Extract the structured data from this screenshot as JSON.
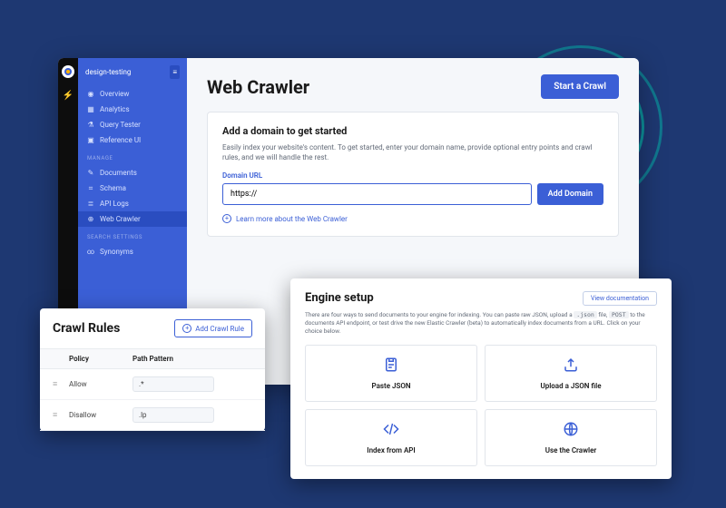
{
  "sidebar": {
    "project_name": "design-testing",
    "groups": [
      {
        "label": "",
        "items": [
          {
            "label": "Overview",
            "icon": "eye"
          },
          {
            "label": "Analytics",
            "icon": "bars"
          },
          {
            "label": "Query Tester",
            "icon": "flask"
          },
          {
            "label": "Reference UI",
            "icon": "layout"
          }
        ]
      },
      {
        "label": "MANAGE",
        "items": [
          {
            "label": "Documents",
            "icon": "doc"
          },
          {
            "label": "Schema",
            "icon": "schema"
          },
          {
            "label": "API Logs",
            "icon": "logs"
          },
          {
            "label": "Web Crawler",
            "icon": "globe",
            "active": true
          }
        ]
      },
      {
        "label": "SEARCH SETTINGS",
        "items": [
          {
            "label": "Synonyms",
            "icon": "link"
          }
        ]
      }
    ]
  },
  "page": {
    "title": "Web Crawler",
    "start_label": "Start a Crawl"
  },
  "domain_card": {
    "heading": "Add a domain to get started",
    "desc": "Easily index your website's content. To get started, enter your domain name, provide optional entry points and crawl rules, and we will handle the rest.",
    "field_label": "Domain URL",
    "input_value": "https://",
    "add_label": "Add Domain",
    "learn_label": "Learn more about the Web Crawler"
  },
  "engine": {
    "heading": "Engine setup",
    "view_doc_label": "View documentation",
    "desc_pre": "There are four ways to send documents to your engine for indexing. You can paste raw JSON, upload a ",
    "code1": ".json",
    "desc_mid1": " file, ",
    "code2": "POST",
    "desc_mid2": " to the documents API ",
    "desc_end": " endpoint, or test drive the new Elastic Crawler (beta) to automatically index documents from a URL. Click on your choice below.",
    "tiles": [
      {
        "label": "Paste JSON",
        "icon": "paste"
      },
      {
        "label": "Upload a JSON file",
        "icon": "upload"
      },
      {
        "label": "Index from API",
        "icon": "code"
      },
      {
        "label": "Use the Crawler",
        "icon": "globe"
      }
    ]
  },
  "rules": {
    "heading": "Crawl Rules",
    "add_label": "Add Crawl Rule",
    "col_policy": "Policy",
    "col_pattern": "Path Pattern",
    "rows": [
      {
        "policy": "Allow",
        "pattern": ".*"
      },
      {
        "policy": "Disallow",
        "pattern": ".lp"
      }
    ]
  }
}
